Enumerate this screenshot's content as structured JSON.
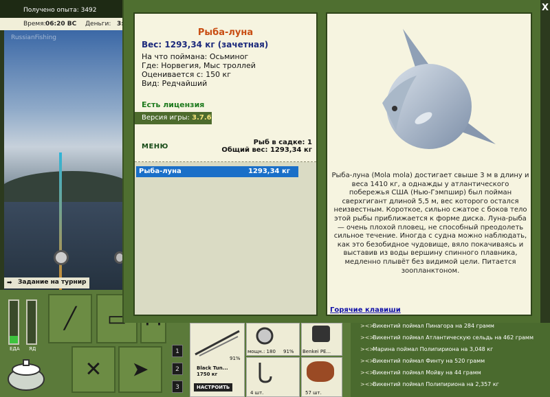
{
  "status": {
    "xp_text": "Получено опыта: 3492",
    "time_label": "Время:",
    "time_value": "06:20 ВС",
    "money_label": "Деньги:",
    "money_value": "3:"
  },
  "scene": {
    "watermark": "RussianFishing"
  },
  "tournament_task": "Задание на турнир",
  "hud": {
    "food_label": "ЕДА",
    "poison_label": "ЯД",
    "food_level": 0.18,
    "poison_level": 0.0,
    "slots": [
      "1",
      "2",
      "3"
    ]
  },
  "gear": {
    "rod_name": "Black Tun...",
    "rod_weight": "1750 кг",
    "rod_percent": "91%",
    "reel_power": "мощн.: 180",
    "reel_percent": "91%",
    "line_name": "Benkei PE...",
    "hooks_count": "4 шт.",
    "bait_count": "57 шт.",
    "setup_button": "НАСТРОИТЬ"
  },
  "feed": [
    "Викентий поймал Пинагора на 284 грамм",
    "Викентий поймал Атлантическую сельдь на 462 грамм",
    "Марина поймал Полипириона на 3,048 кг",
    "Викентий поймал Финту на 520 грамм",
    "Викентий поймал Мойву на 44 грамм",
    "Викентий поймал Полипириона на 2,357 кг"
  ],
  "dialog": {
    "close": "X",
    "fish_name": "Рыба-луна",
    "weight_line": "Вес: 1293,34 кг (зачетная)",
    "caught_on": "На что поймана: Осьминог",
    "where": "Где: Норвегия, Мыс троллей",
    "rated_from": "Оценивается с: 150 кг",
    "kind": "Вид: Редчайший",
    "license": "Есть лицензия",
    "version_label": "Версия игры:",
    "version_value": "3.7.6",
    "menu": "МЕНЮ",
    "fish_in_basket": "Рыб в садке: 1",
    "total_weight": "Общий вес: 1293,34 кг",
    "list": [
      {
        "name": "Рыба-луна",
        "weight": "1293,34 кг"
      }
    ],
    "description": "Рыба-луна (Mola mola) достигает свыше 3 м в длину и веса 1410 кг, а однажды у атлантического побережья США (Нью-Гэмпшир) был пойман сверхгигант длиной 5,5 м, вес которого остался неизвестным. Короткое, сильно сжатое с боков тело этой рыбы приближается к форме диска. Луна-рыба — очень плохой пловец, не способный преодолеть сильное течение. Иногда с судна можно наблюдать, как это безобидное чудовище, вяло покачиваясь и выставив из воды вершину спинного плавника, медленно плывёт без видимой цели. Питается зоопланктоном.",
    "hotkeys": "Горячие клавиши"
  },
  "colors": {
    "panel_bg": "#f6f4e0",
    "frame_green": "#4f6f30",
    "title_orange": "#c84d12",
    "weight_blue": "#1c2a7c",
    "license_green": "#1d7a1d",
    "selection_blue": "#1a6fc8",
    "link_blue": "#1212a8"
  },
  "icons": {
    "close": "close-icon",
    "arrow": "arrow-right-icon",
    "fish": "fish-icon"
  }
}
